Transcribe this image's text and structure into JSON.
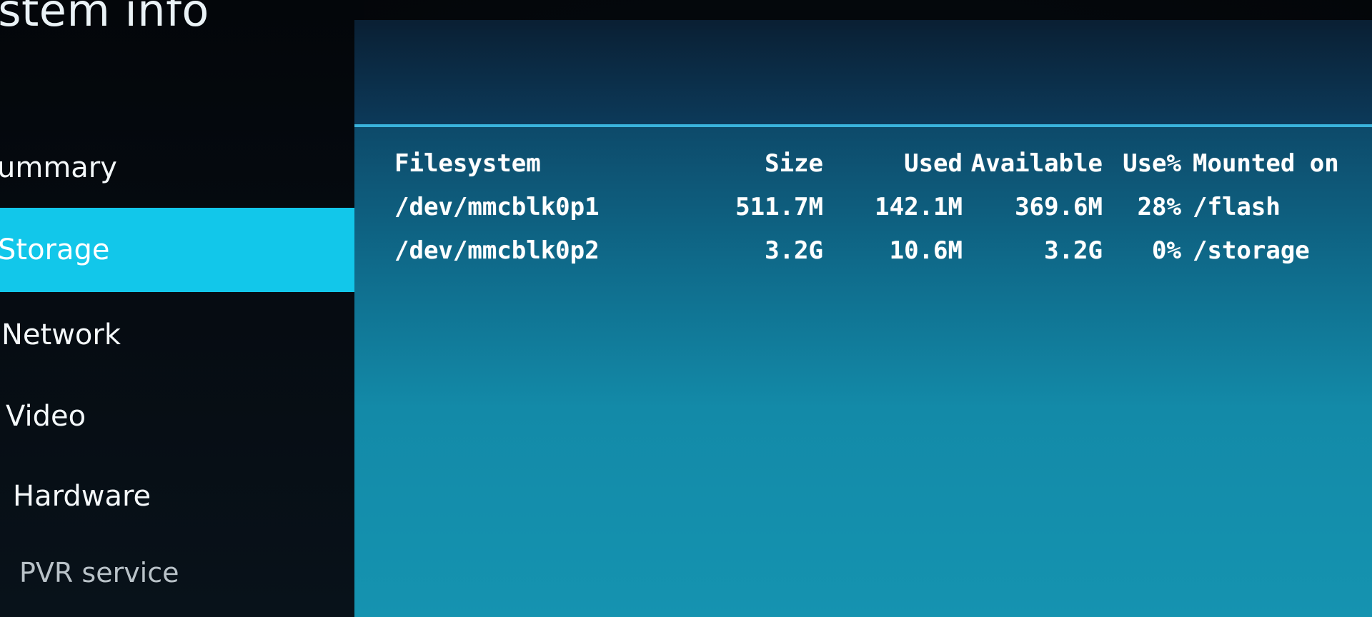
{
  "window": {
    "title": "ystem info"
  },
  "sidebar": {
    "items": [
      {
        "label": "ummary",
        "selected": false
      },
      {
        "label": "Storage",
        "selected": true
      },
      {
        "label": "Network",
        "selected": false
      },
      {
        "label": "Video",
        "selected": false
      },
      {
        "label": "Hardware",
        "selected": false
      },
      {
        "label": "PVR service",
        "selected": false
      }
    ]
  },
  "storage": {
    "columns": {
      "filesystem": "Filesystem",
      "size": "Size",
      "used": "Used",
      "available": "Available",
      "use_pct": "Use%",
      "mounted_on": "Mounted on"
    },
    "rows": [
      {
        "filesystem": "/dev/mmcblk0p1",
        "size": "511.7M",
        "used": "142.1M",
        "available": "369.6M",
        "use_pct": "28%",
        "mounted_on": "/flash"
      },
      {
        "filesystem": "/dev/mmcblk0p2",
        "size": "3.2G",
        "used": "10.6M",
        "available": "3.2G",
        "use_pct": "0%",
        "mounted_on": "/storage"
      }
    ]
  },
  "colors": {
    "selection": "#12c7ea",
    "rule": "#3ab3dc",
    "panel_bottom": "#1593b0"
  }
}
